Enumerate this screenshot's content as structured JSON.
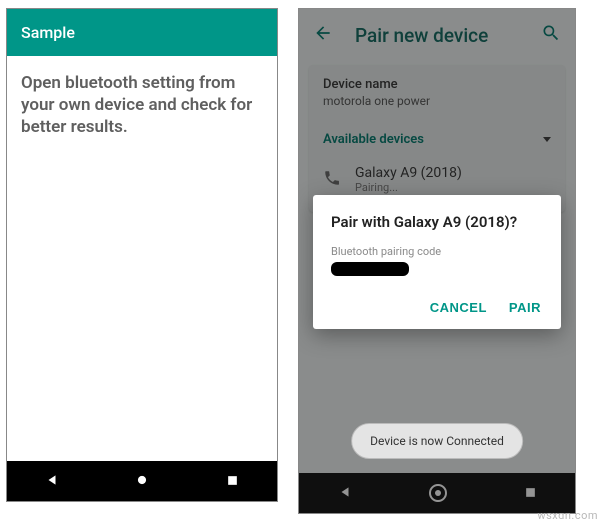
{
  "leftPhone": {
    "appTitle": "Sample",
    "bodyText": "Open bluetooth setting from your own device and check for better results."
  },
  "rightPhone": {
    "header": {
      "title": "Pair new device"
    },
    "deviceName": {
      "label": "Device name",
      "value": "motorola one power"
    },
    "availableLabel": "Available devices",
    "foundDevice": {
      "name": "Galaxy A9 (2018)",
      "status": "Pairing..."
    },
    "dialog": {
      "title": "Pair with Galaxy A9 (2018)?",
      "subText": "Bluetooth pairing code",
      "cancel": "CANCEL",
      "pair": "PAIR"
    },
    "toast": "Device is now Connected"
  },
  "watermark": "wsxdn.com"
}
